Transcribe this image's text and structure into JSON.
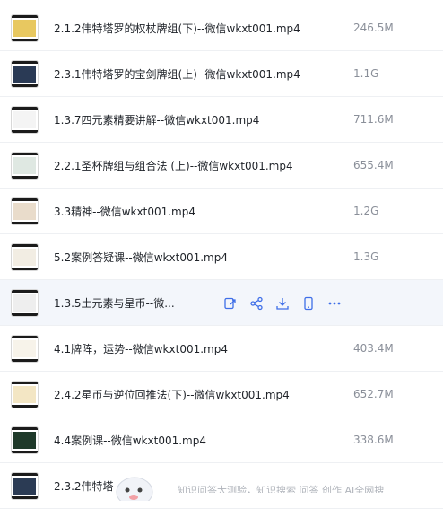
{
  "files": [
    {
      "name": "2.1.2伟特塔罗的权杖牌组(下)--微信wkxt001.mp4",
      "size": "246.5M",
      "thumb": "#e8c860"
    },
    {
      "name": "2.3.1伟特塔罗的宝剑牌组(上)--微信wkxt001.mp4",
      "size": "1.1G",
      "thumb": "#2a3a55"
    },
    {
      "name": "1.3.7四元素精要讲解--微信wkxt001.mp4",
      "size": "711.6M",
      "thumb": "#f4f4f4"
    },
    {
      "name": "2.2.1圣杯牌组与组合法 (上)--微信wkxt001.mp4",
      "size": "655.4M",
      "thumb": "#dfe8e2"
    },
    {
      "name": "3.3精神--微信wkxt001.mp4",
      "size": "1.2G",
      "thumb": "#e9dccb"
    },
    {
      "name": "5.2案例答疑课--微信wkxt001.mp4",
      "size": "1.3G",
      "thumb": "#f2ede3"
    },
    {
      "name": "1.3.5土元素与星币--微...",
      "size": "",
      "thumb": "#eeeeee",
      "hover": true
    },
    {
      "name": "4.1牌阵，运势--微信wkxt001.mp4",
      "size": "403.4M",
      "thumb": "#f7f3ea"
    },
    {
      "name": "2.4.2星币与逆位回推法(下)--微信wkxt001.mp4",
      "size": "652.7M",
      "thumb": "#f3e6c4"
    },
    {
      "name": "4.4案例课--微信wkxt001.mp4",
      "size": "338.6M",
      "thumb": "#1f3a2a"
    },
    {
      "name": "2.3.2伟特塔",
      "size": "",
      "thumb": "#2b3b54"
    }
  ],
  "hover_actions": [
    "share-link-icon",
    "share-icon",
    "download-icon",
    "phone-icon",
    "more-icon"
  ],
  "tip_text": "知识问答大测验，知识搜索 问答 创作 AI全网搜",
  "colors": {
    "accent": "#3e6ee8",
    "hover_bg": "#f3f6fb",
    "size_text": "#8a8f99"
  }
}
